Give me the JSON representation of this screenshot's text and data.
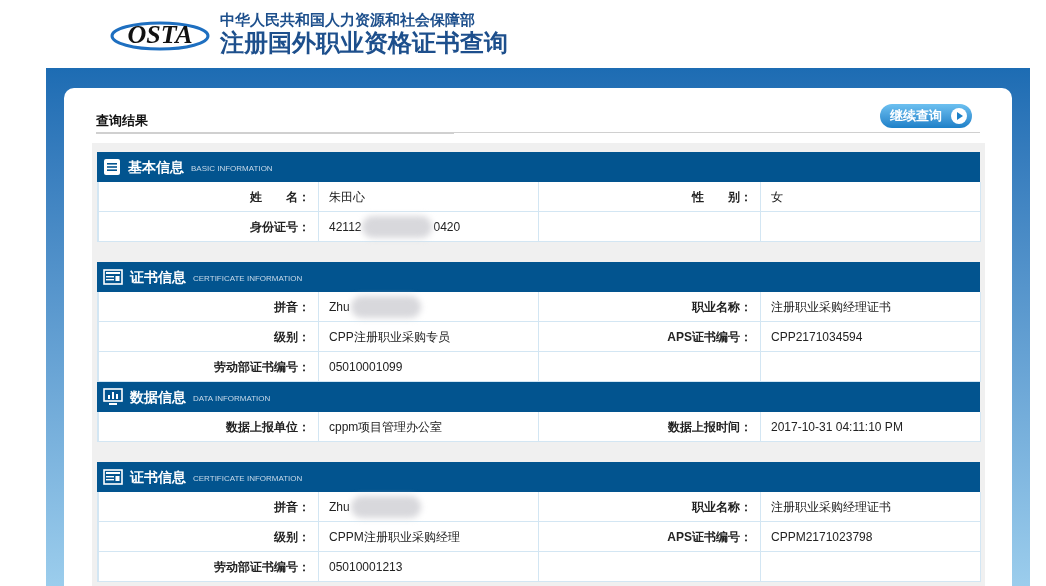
{
  "header": {
    "logo": "OSTA",
    "ministry": "中华人民共和国人力资源和社会保障部",
    "title": "注册国外职业资格证书查询"
  },
  "result": {
    "heading": "查询结果",
    "button": "继续查询"
  },
  "sections": [
    {
      "kind": "basic",
      "title": "基本信息",
      "subtitle": "BASIC INFORMATION",
      "rows": [
        {
          "cells": [
            {
              "label": "姓　　名：",
              "value": [
                "朱田心"
              ]
            },
            {
              "label": "性　　别：",
              "value": [
                "女"
              ]
            }
          ]
        },
        {
          "cells": [
            {
              "label": "身份证号：",
              "value": [
                "42112",
                "0420"
              ]
            }
          ]
        }
      ]
    },
    {
      "kind": "certificate",
      "title": "证书信息",
      "subtitle": "CERTIFICATE INFORMATION",
      "gap_before": true,
      "rows": [
        {
          "cells": [
            {
              "label": "拼音：",
              "value": [
                "Zhu"
              ],
              "masked": true
            },
            {
              "label": "职业名称：",
              "value": [
                "注册职业采购经理证书"
              ]
            }
          ]
        },
        {
          "cells": [
            {
              "label": "级别：",
              "value": [
                "CPP注册职业采购专员"
              ]
            },
            {
              "label": "APS证书编号：",
              "value": [
                "CPP2171034594"
              ]
            }
          ]
        },
        {
          "cells": [
            {
              "label": "劳动部证书编号：",
              "value": [
                "05010001099"
              ]
            }
          ]
        }
      ]
    },
    {
      "kind": "data",
      "title": "数据信息",
      "subtitle": "DATA INFORMATION",
      "gap_before": false,
      "rows": [
        {
          "cells": [
            {
              "label": "数据上报单位：",
              "value": [
                "cppm项目管理办公室"
              ]
            },
            {
              "label": "数据上报时间：",
              "value": [
                "2017-10-31 04:11:10 PM"
              ]
            }
          ]
        }
      ]
    },
    {
      "kind": "certificate",
      "title": "证书信息",
      "subtitle": "CERTIFICATE INFORMATION",
      "gap_before": true,
      "rows": [
        {
          "cells": [
            {
              "label": "拼音：",
              "value": [
                "Zhu"
              ],
              "masked": true
            },
            {
              "label": "职业名称：",
              "value": [
                "注册职业采购经理证书"
              ]
            }
          ]
        },
        {
          "cells": [
            {
              "label": "级别：",
              "value": [
                "CPPM注册职业采购经理"
              ]
            },
            {
              "label": "APS证书编号：",
              "value": [
                "CPPM2171023798"
              ]
            }
          ]
        },
        {
          "cells": [
            {
              "label": "劳动部证书编号：",
              "value": [
                "05010001213"
              ]
            }
          ]
        }
      ]
    }
  ]
}
